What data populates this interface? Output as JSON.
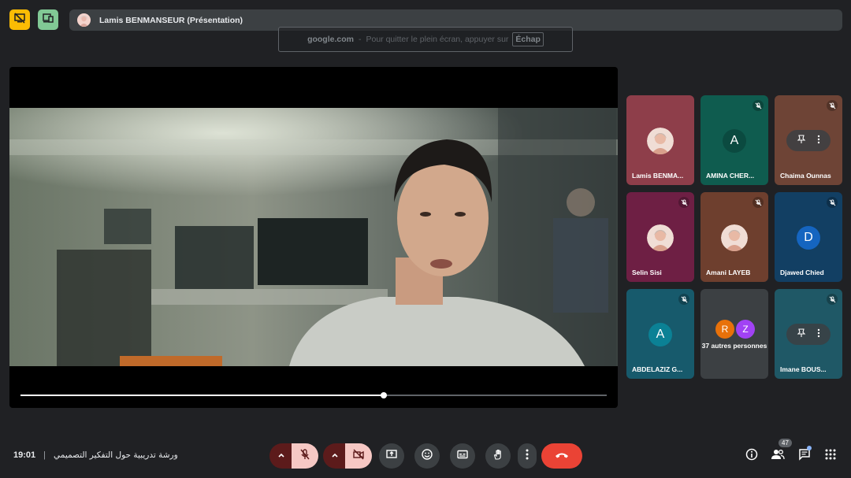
{
  "header": {
    "presenter_title": "Lamis BENMANSEUR (Présentation)",
    "presenter_avatar_icon": "avatar-photo",
    "stop_presenting_icon": "stop-present-icon",
    "layout_icon": "devices-icon"
  },
  "fullscreen_toast": {
    "domain": "google.com",
    "separator": "-",
    "message": "Pour quitter le plein écran, appuyer sur",
    "key": "Échap"
  },
  "stage": {
    "video_progress": 0.62
  },
  "participants": [
    {
      "name": "Lamis BENMA...",
      "avatar": "photo",
      "muted": false,
      "bg": "#8e3e4a"
    },
    {
      "name": "AMINA CHER...",
      "avatar": "letter",
      "letter": "A",
      "muted": true,
      "bg": "#0f5c4f",
      "letter_bg": "#0b4a40"
    },
    {
      "name": "Chaima Ounnas",
      "avatar": "pin-more",
      "muted": true,
      "bg": "#6e4436"
    },
    {
      "name": "Selin Sisi",
      "avatar": "photo",
      "muted": true,
      "bg": "#6e1f44"
    },
    {
      "name": "Amani LAYEB",
      "avatar": "photo",
      "muted": true,
      "bg": "#6e3f2e"
    },
    {
      "name": "Djawed Chied",
      "avatar": "letter",
      "letter": "D",
      "muted": true,
      "bg": "#123f63",
      "letter_bg": "#1565c0"
    },
    {
      "name": "ABDELAZIZ G...",
      "avatar": "letter",
      "letter": "A",
      "muted": true,
      "bg": "#175a6c",
      "letter_bg": "#0b8195"
    },
    {
      "name": "37 autres personnes",
      "avatar": "group",
      "letters": [
        "R",
        "Z"
      ],
      "muted": false,
      "bg": "#3c4043"
    },
    {
      "name": "Imane BOUS...",
      "avatar": "pin-more",
      "muted": true,
      "bg": "#1f5866"
    }
  ],
  "footer": {
    "time": "19:01",
    "separator": "|",
    "meeting_title": "ورشة تدريبية حول التفكير التصميمي",
    "people_count": "47"
  },
  "colors": {
    "background": "#202124",
    "end_call": "#ea4335",
    "muted_button": "#f6c8c4",
    "presenting_yellow": "#fbbc04",
    "layout_green": "#81c995"
  }
}
